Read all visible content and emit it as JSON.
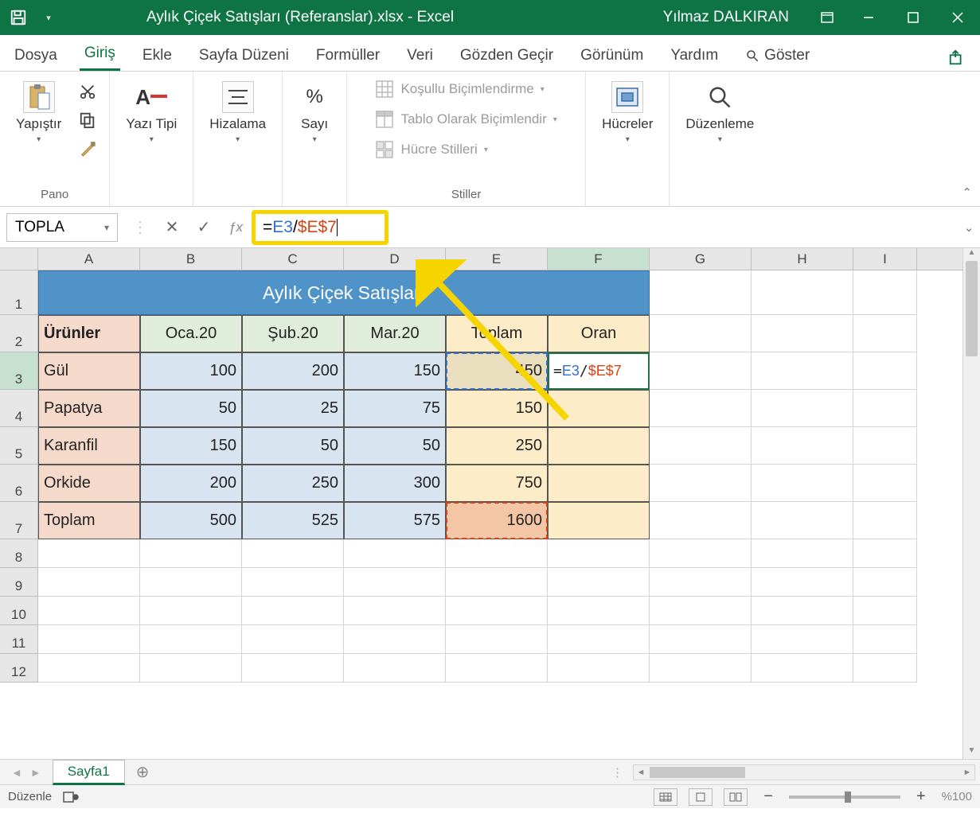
{
  "titlebar": {
    "filename": "Aylık Çiçek Satışları (Referanslar).xlsx  -  Excel",
    "user": "Yılmaz DALKIRAN"
  },
  "ribbon_tabs": [
    "Dosya",
    "Giriş",
    "Ekle",
    "Sayfa Düzeni",
    "Formüller",
    "Veri",
    "Gözden Geçir",
    "Görünüm",
    "Yardım"
  ],
  "search_tab": "Göster",
  "ribbon": {
    "pano": {
      "paste": "Yapıştır",
      "label": "Pano"
    },
    "font": {
      "btn": "Yazı Tipi"
    },
    "align": {
      "btn": "Hizalama"
    },
    "number": {
      "btn": "Sayı"
    },
    "styles": {
      "cond": "Koşullu Biçimlendirme",
      "table": "Tablo Olarak Biçimlendir",
      "cell": "Hücre Stilleri",
      "label": "Stiller"
    },
    "cells": {
      "btn": "Hücreler"
    },
    "editing": {
      "btn": "Düzenleme"
    }
  },
  "formula_bar": {
    "namebox": "TOPLA",
    "formula_prefix": "=",
    "formula_ref1": "E3",
    "formula_op": "/",
    "formula_ref2": "$E$7"
  },
  "columns": [
    "A",
    "B",
    "C",
    "D",
    "E",
    "F",
    "G",
    "H",
    "I"
  ],
  "sheet": {
    "title": "Aylık Çiçek Satışları",
    "header_products": "Ürünler",
    "months": [
      "Oca.20",
      "Şub.20",
      "Mar.20"
    ],
    "header_total": "Toplam",
    "header_ratio": "Oran",
    "rows": [
      {
        "name": "Gül",
        "v": [
          "100",
          "200",
          "150"
        ],
        "total": "450"
      },
      {
        "name": "Papatya",
        "v": [
          "50",
          "25",
          "75"
        ],
        "total": "150"
      },
      {
        "name": "Karanfil",
        "v": [
          "150",
          "50",
          "50"
        ],
        "total": "250"
      },
      {
        "name": "Orkide",
        "v": [
          "200",
          "250",
          "300"
        ],
        "total": "750"
      }
    ],
    "footer_label": "Toplam",
    "footer": [
      "500",
      "525",
      "575"
    ],
    "footer_total": "1600",
    "editing_formula": "=E3/$E$7"
  },
  "sheet_tab": "Sayfa1",
  "statusbar": {
    "mode": "Düzenle",
    "zoom": "%100"
  }
}
